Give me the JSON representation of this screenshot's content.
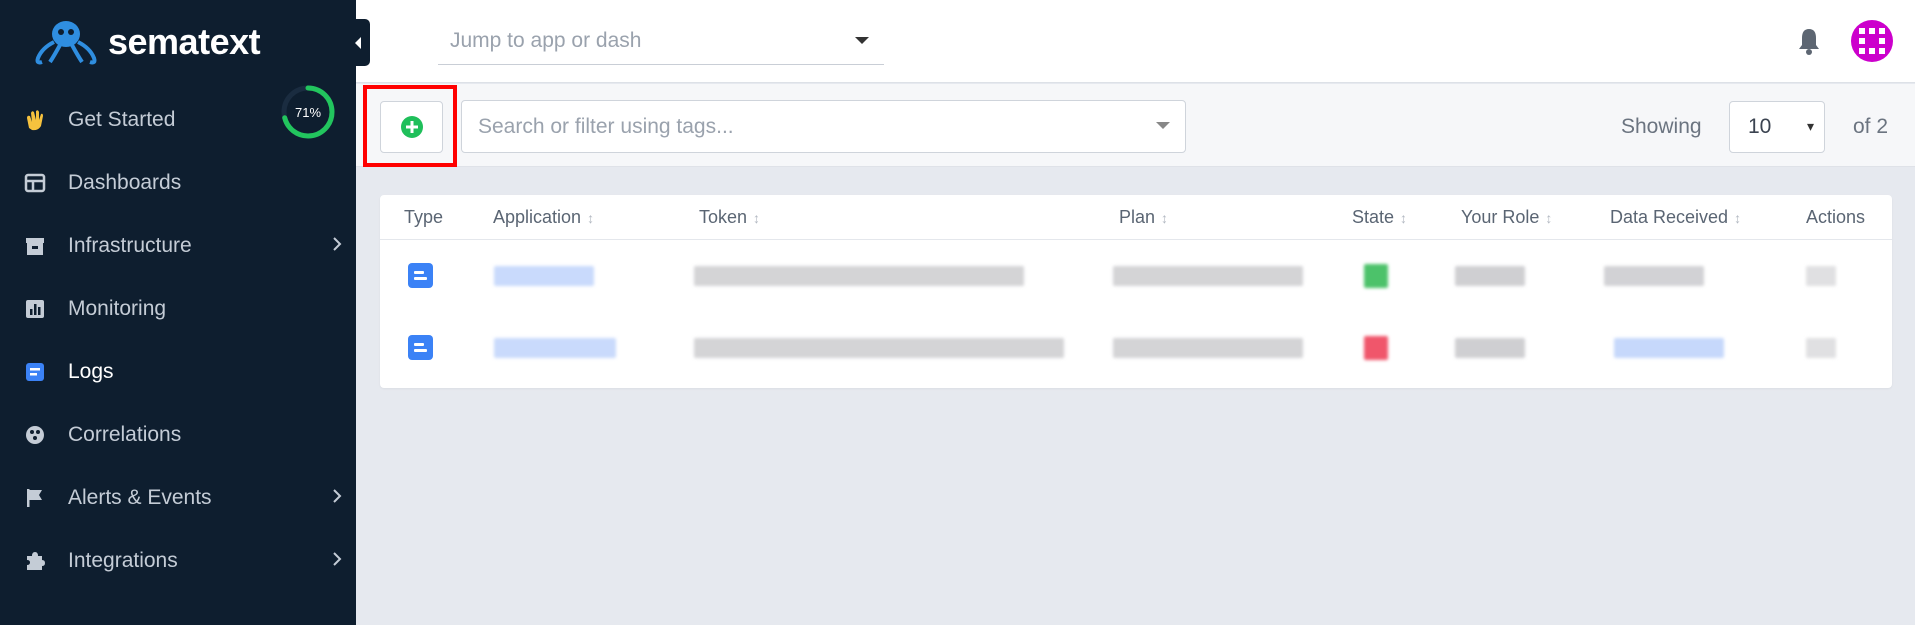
{
  "brand": {
    "name": "sematext"
  },
  "sidebar": {
    "items": [
      {
        "label": "Get Started",
        "icon": "waving-hand-icon",
        "progress": 71,
        "progress_label": "71%"
      },
      {
        "label": "Dashboards",
        "icon": "dashboard-icon"
      },
      {
        "label": "Infrastructure",
        "icon": "infrastructure-icon",
        "has_submenu": true
      },
      {
        "label": "Monitoring",
        "icon": "bar-chart-icon"
      },
      {
        "label": "Logs",
        "icon": "logs-icon",
        "active": true
      },
      {
        "label": "Correlations",
        "icon": "correlations-icon"
      },
      {
        "label": "Alerts & Events",
        "icon": "flag-icon",
        "has_submenu": true
      },
      {
        "label": "Integrations",
        "icon": "puzzle-icon",
        "has_submenu": true
      }
    ]
  },
  "topbar": {
    "jump_placeholder": "Jump to app or dash"
  },
  "filterbar": {
    "search_placeholder": "Search or filter using tags...",
    "showing_label": "Showing",
    "page_size": "10",
    "of_total": "of 2"
  },
  "table": {
    "columns": [
      "Type",
      "Application",
      "Token",
      "Plan",
      "State",
      "Your Role",
      "Data Received",
      "Actions"
    ]
  },
  "colors": {
    "sidebar_bg": "#0e1e2f",
    "accent_blue": "#3b82f6",
    "add_green": "#1fbf5a",
    "state_active": "#4cc26a",
    "state_inactive": "#f0566b",
    "highlight_red": "#ff0000"
  }
}
